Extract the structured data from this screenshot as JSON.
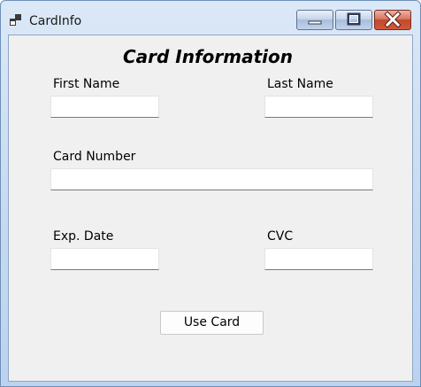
{
  "window": {
    "title": "CardInfo",
    "app_icon": "stacked-windows-icon",
    "controls": {
      "minimize_icon": "minimize-icon",
      "maximize_icon": "maximize-icon",
      "close_icon": "close-icon"
    }
  },
  "form": {
    "heading": "Card Information",
    "first_name": {
      "label": "First Name",
      "value": ""
    },
    "last_name": {
      "label": "Last Name",
      "value": ""
    },
    "card_number": {
      "label": "Card Number",
      "value": ""
    },
    "exp_date": {
      "label": "Exp. Date",
      "value": ""
    },
    "cvc": {
      "label": "CVC",
      "value": ""
    },
    "submit_label": "Use Card"
  },
  "colors": {
    "client_background": "#f0f0f0",
    "close_button": "#c2482c",
    "titlebar": "#c6d9f0"
  }
}
